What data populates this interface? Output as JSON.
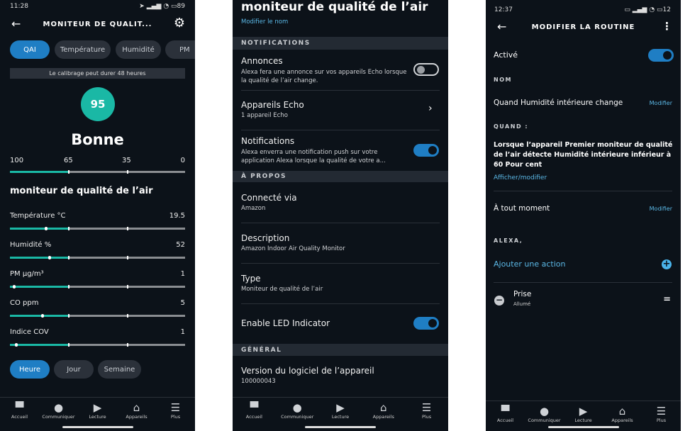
{
  "colors": {
    "accent": "#1f7ec4",
    "teal": "#1ab8a5",
    "bg": "#0c1219",
    "link": "#5bb8e6"
  },
  "left": {
    "status": {
      "time": "11:28",
      "battery": "89"
    },
    "header": {
      "title": "MONITEUR DE QUALIT...",
      "back_icon": "arrow-left",
      "settings_icon": "gear"
    },
    "chips": [
      "QAI",
      "Température",
      "Humidité",
      "PM"
    ],
    "calibration": "Le calibrage peut durer 48 heures",
    "score": "95",
    "rating": "Bonne",
    "scale": [
      "100",
      "65",
      "35",
      "0"
    ],
    "device_title": "moniteur de qualité de l’air",
    "metrics": [
      {
        "label": "Température °C",
        "value": "19.5",
        "level": 0.19
      },
      {
        "label": "Humidité %",
        "value": "52",
        "level": 0.21
      },
      {
        "label": "PM µg/m³",
        "value": "1",
        "level": 0.01
      },
      {
        "label": "CO ppm",
        "value": "5",
        "level": 0.17
      },
      {
        "label": "Indice COV",
        "value": "1",
        "level": 0.02
      }
    ],
    "ranges": [
      "Heure",
      "Jour",
      "Semaine"
    ]
  },
  "middle": {
    "title": "moniteur de qualité de l’air",
    "rename": "Modifier le nom",
    "sections": {
      "notifications": "NOTIFICATIONS",
      "about": "À PROPOS",
      "general": "GÉNÉRAL"
    },
    "annonces": {
      "title": "Annonces",
      "desc1": "Alexa fera une annonce sur vos appareils Echo lorsque",
      "desc2": "la qualité de l’air change.",
      "enabled": false
    },
    "echo": {
      "title": "Appareils Echo",
      "sub": "1 appareil Echo"
    },
    "notifications": {
      "title": "Notifications",
      "desc1": "Alexa enverra une notification push sur votre",
      "desc2": "application Alexa lorsque la qualité de votre a...",
      "enabled": true
    },
    "connected": {
      "title": "Connecté via",
      "sub": "Amazon"
    },
    "description": {
      "title": "Description",
      "sub": "Amazon Indoor Air Quality Monitor"
    },
    "type": {
      "title": "Type",
      "sub": "Moniteur de qualité de l’air"
    },
    "led": {
      "title": "Enable LED Indicator",
      "enabled": true
    },
    "version": {
      "title": "Version du logiciel de l’appareil",
      "sub": "100000043"
    }
  },
  "right": {
    "status": {
      "time": "12:37",
      "battery": "12"
    },
    "header": {
      "title": "MODIFIER LA ROUTINE"
    },
    "active": {
      "label": "Activé",
      "enabled": true
    },
    "name_cap": "NOM",
    "name": "Quand Humidité intérieure change",
    "modify": "Modifier",
    "when_cap": "QUAND :",
    "when1": "Lorsque l’appareil Premier moniteur de qualité",
    "when2": "de l’air détecte Humidité intérieure inférieur à",
    "when3": "60 Pour cent",
    "view_edit": "Afficher/modifier",
    "anytime": "À tout moment",
    "modify2": "Modifier",
    "alexa_cap": "ALEXA,",
    "add_action": "Ajouter une action",
    "action": {
      "title": "Prise",
      "sub": "Allumé"
    }
  },
  "nav": [
    "Accueil",
    "Communiquer",
    "Lecture",
    "Appareils",
    "Plus"
  ]
}
